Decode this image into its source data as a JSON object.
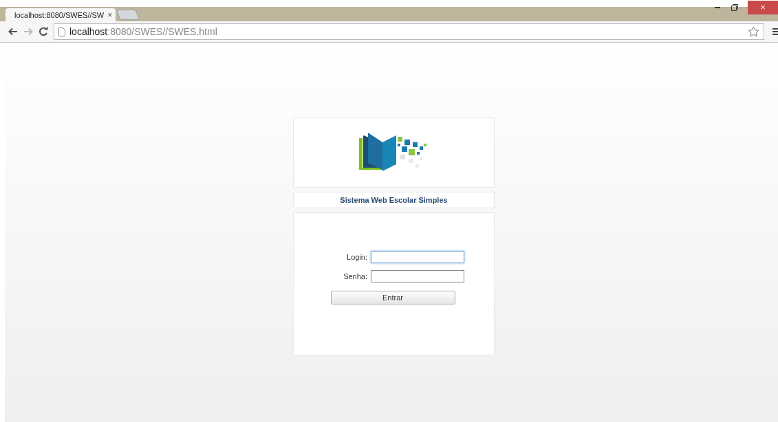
{
  "browser": {
    "tab": {
      "title": "localhost:8080/SWES//SW",
      "close": "×",
      "selected": true
    },
    "address": {
      "host": "localhost",
      "rest": ":8080/SWES//SWES.html"
    },
    "window_controls": {
      "close": "×"
    }
  },
  "app": {
    "title": "Sistema Web Escolar Simples",
    "fields": [
      {
        "label": "Login:",
        "focused": true
      },
      {
        "label": "Senha:",
        "focused": false
      }
    ],
    "button": "Entrar"
  }
}
